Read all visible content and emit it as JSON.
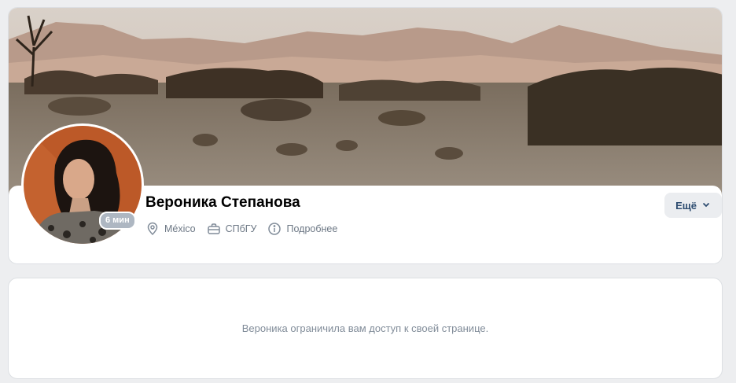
{
  "profile": {
    "name": "Вероника Степанова",
    "online_status": "6 мин",
    "location": "México",
    "education": "СПбГУ",
    "details_link": "Подробнее",
    "more_button": "Ещё"
  },
  "notice": {
    "text": "Вероника ограничила вам доступ к своей странице."
  },
  "icons": {
    "location": "location-pin-icon",
    "education": "briefcase-icon",
    "details": "info-icon",
    "more": "chevron-down-icon"
  },
  "colors": {
    "page_background": "#edeef0",
    "card_background": "#ffffff",
    "name": "#000000",
    "meta_text": "#6d7885",
    "button_bg": "#ebedf0",
    "button_text": "#2d4c70",
    "badge_bg": "#aeb7c2",
    "notice_text": "#818c99"
  }
}
